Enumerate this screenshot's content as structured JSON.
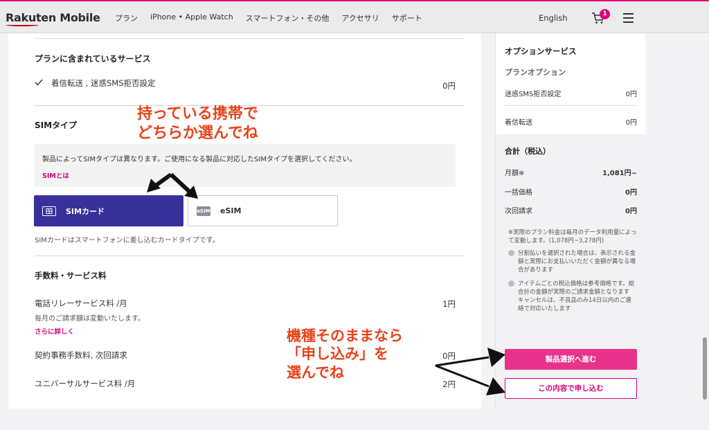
{
  "header": {
    "logo": "Rakuten Mobile",
    "nav": [
      "プラン",
      "iPhone • Apple Watch",
      "スマートフォン・その他",
      "アクセサリ",
      "サポート"
    ],
    "lang": "English",
    "cart_count": "1"
  },
  "main": {
    "included": {
      "heading": "プランに含まれているサービス",
      "item": "着信転送 , 迷惑SMS拒否設定",
      "price": "0円"
    },
    "sim": {
      "heading": "SIMタイプ",
      "info": "製品によってSIMタイプは異なります。ご使用になる製品に対応したSIMタイプを選択してください。",
      "info_link": "SIMとは",
      "options": [
        {
          "label": "SIMカード",
          "selected": true
        },
        {
          "label": "eSIM",
          "icon_text": "eSIM",
          "selected": false
        }
      ],
      "caption": "SIMカードはスマートフォンに差し込むカードタイプです。"
    },
    "fees": {
      "heading": "手数料・サービス料",
      "relay_label": "電話リレーサービス料 /月",
      "relay_price": "1円",
      "relay_note": "毎月のご請求額は変動いたします。",
      "more_link": "さらに詳しく",
      "contract_label": "契約事務手数料, 次回請求",
      "contract_price": "0円",
      "universal_label": "ユニバーサルサービス料 /月",
      "universal_price": "2円"
    }
  },
  "sidebar": {
    "option_heading": "オプションサービス",
    "plan_option_heading": "プランオプション",
    "options": [
      {
        "label": "迷惑SMS拒否設定",
        "price": "0円"
      },
      {
        "label": "着信転送",
        "price": "0円"
      }
    ],
    "total_heading": "合計（税込）",
    "totals": [
      {
        "label": "月額※",
        "value": "1,081円~"
      },
      {
        "label": "一括価格",
        "value": "0円"
      },
      {
        "label": "次回請求",
        "value": "0円"
      }
    ],
    "note_main": "※実際のプラン料金は毎月のデータ利用量によって変動します。(1,078円~3,278円)",
    "note_installment": "分割払いを選択された場合は、表示される金額と実際にお支払いいただく金額が異なる場合があります",
    "note_price": "アイテムごとの税込価格は参考価格です。総合計の金額が実際のご請求金額となります",
    "note_cancel": "キャンセルは、不良品のみ14日以内のご連絡で対応いたします",
    "btn_primary": "製品選択へ進む",
    "btn_secondary": "この内容で申し込む"
  },
  "annotations": {
    "sim_line1": "持っている携帯で",
    "sim_line2": "どちらか選んでね",
    "apply_line1": "機種そのままなら",
    "apply_line2": "「申し込み」を",
    "apply_line3": "選んでね"
  },
  "colors": {
    "accent_pink": "#e8338a",
    "sim_selected": "#38319c",
    "annotation": "#e8431a"
  }
}
